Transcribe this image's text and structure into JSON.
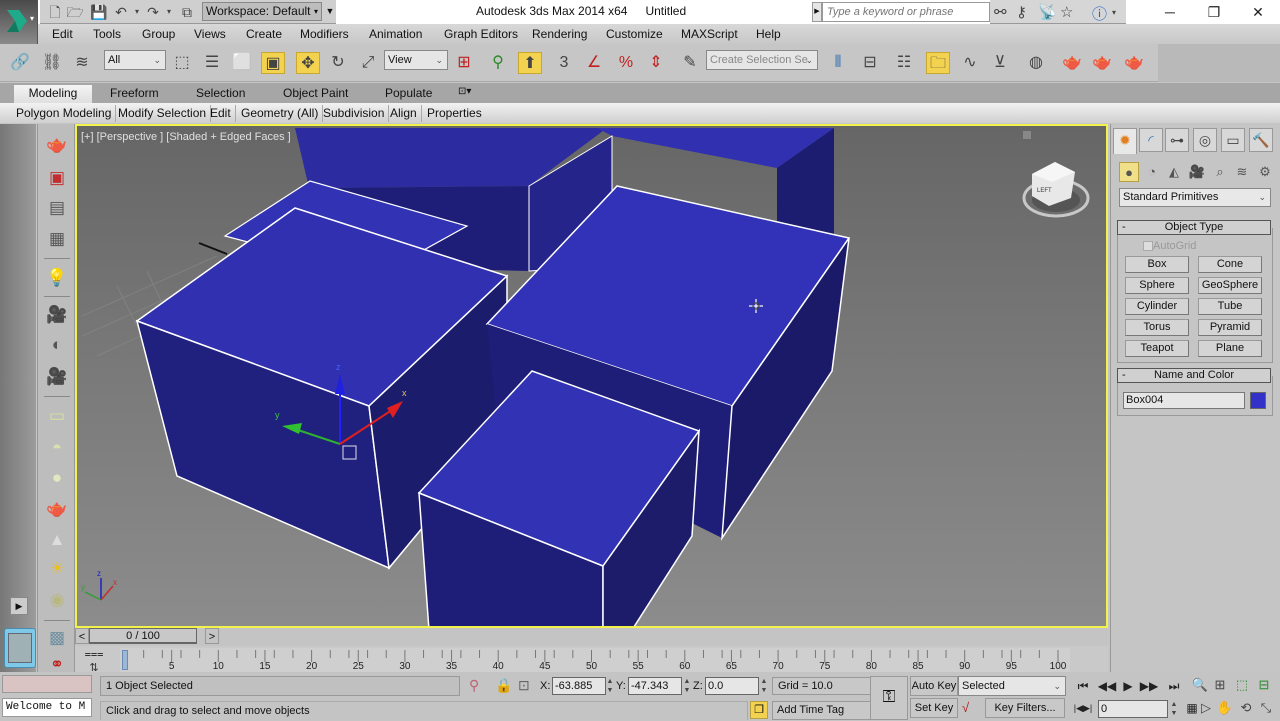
{
  "titlebar": {
    "workspace_label": "Workspace: Default",
    "app_name": "Autodesk 3ds Max  2014 x64",
    "document": "Untitled",
    "search_placeholder": "Type a keyword or phrase",
    "quick_access_icons": [
      "new-file-icon",
      "open-file-icon",
      "save-icon",
      "undo-icon",
      "redo-icon",
      "project-folder-icon"
    ],
    "search_icons": [
      "binoculars-icon",
      "key-icon",
      "satellite-icon",
      "star-icon",
      "help-icon"
    ],
    "window_controls": [
      "minimize",
      "restore",
      "close"
    ]
  },
  "menu": [
    "Edit",
    "Tools",
    "Group",
    "Views",
    "Create",
    "Modifiers",
    "Animation",
    "Graph Editors",
    "Rendering",
    "Customize",
    "MAXScript",
    "Help"
  ],
  "main_toolbar": {
    "selection_filter": "All",
    "reference_coord": "View",
    "named_selection_placeholder": "Create Selection Se",
    "snap_labels": [
      "3",
      "%"
    ]
  },
  "ribbon": {
    "tabs": [
      "Modeling",
      "Freeform",
      "Selection",
      "Object Paint",
      "Populate"
    ],
    "active_tab": "Modeling",
    "panels": [
      "Polygon Modeling",
      "Modify Selection",
      "Edit",
      "Geometry (All)",
      "Subdivision",
      "Align",
      "Properties"
    ]
  },
  "viewport": {
    "label": "[+] [Perspective ] [Shaded + Edged Faces ]",
    "object_color": "#3232c8",
    "gizmo_axes": [
      "x",
      "y",
      "z"
    ],
    "viewcube_face": "LEFT"
  },
  "command_panel": {
    "tabs": [
      "create",
      "modify",
      "hierarchy",
      "motion",
      "display",
      "utilities"
    ],
    "active_tab": "create",
    "categories": [
      "geometry",
      "shapes",
      "lights",
      "cameras",
      "helpers",
      "space-warps",
      "systems"
    ],
    "category_dropdown": "Standard Primitives",
    "object_type": {
      "title": "Object Type",
      "autogrid_label": "AutoGrid",
      "autogrid_checked": false,
      "buttons": [
        "Box",
        "Cone",
        "Sphere",
        "GeoSphere",
        "Cylinder",
        "Tube",
        "Torus",
        "Pyramid",
        "Teapot",
        "Plane"
      ]
    },
    "name_and_color": {
      "title": "Name and Color",
      "name": "Box004",
      "color": "#3232c8"
    }
  },
  "timeline": {
    "slider_label": "0 / 100",
    "current_frame": 0,
    "total_frames": 100,
    "ticks": [
      "0",
      "5",
      "10",
      "15",
      "20",
      "25",
      "30",
      "35",
      "40",
      "45",
      "50",
      "55",
      "60",
      "65",
      "70",
      "75",
      "80",
      "85",
      "90",
      "95",
      "100"
    ]
  },
  "status": {
    "listener_text": "Welcome to M",
    "selection_count": "1 Object Selected",
    "prompt": "Click and drag to select and move objects",
    "x_label": "X:",
    "x": "-63.885",
    "y_label": "Y:",
    "y": "-47.343",
    "z_label": "Z:",
    "z": "0.0",
    "grid": "Grid = 10.0",
    "add_time_tag": "Add Time Tag",
    "auto_key": "Auto Key",
    "set_key": "Set Key",
    "key_mode": "Selected",
    "key_filters": "Key Filters...",
    "frame_field": "0"
  }
}
